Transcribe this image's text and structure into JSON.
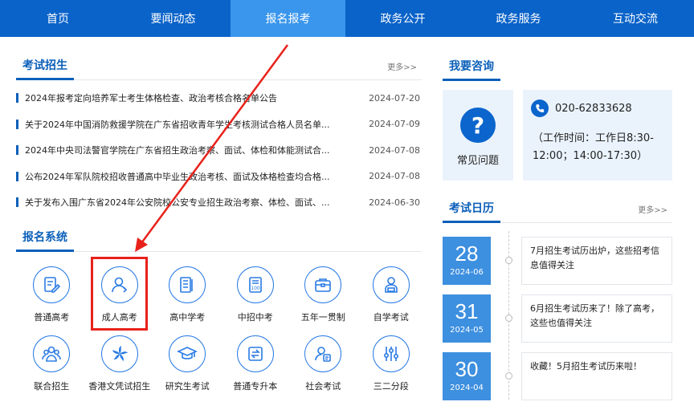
{
  "nav": {
    "items": [
      "首页",
      "要闻动态",
      "报名报考",
      "政务公开",
      "政务服务",
      "互动交流"
    ],
    "active_index": 2
  },
  "exam": {
    "title": "考试招生",
    "more": "更多>>",
    "news": [
      {
        "title": "2024年报考定向培养军士考生体格检查、政治考核合格名单公告",
        "date": "2024-07-20"
      },
      {
        "title": "关于2024年中国消防救援学院在广东省招收青年学生考核测试合格人员名单...",
        "date": "2024-07-09"
      },
      {
        "title": "2024年中央司法警官学院在广东省招生政治考察、面试、体检和体能测试合...",
        "date": "2024-07-08"
      },
      {
        "title": "公布2024年军队院校招收普通高中毕业生政治考核、面试及体格检查均合格...",
        "date": "2024-07-08"
      },
      {
        "title": "关于发布入围广东省2024年公安院校公安专业招生政治考察、体检、面试、...",
        "date": "2024-06-30"
      }
    ]
  },
  "system": {
    "title": "报名系统",
    "items": [
      {
        "label": "普通高考",
        "icon": "exam-pen-icon"
      },
      {
        "label": "成人高考",
        "icon": "adult-person-icon"
      },
      {
        "label": "高中学考",
        "icon": "document-list-icon"
      },
      {
        "label": "中招中考",
        "icon": "doc-100-icon"
      },
      {
        "label": "五年一贯制",
        "icon": "briefcase-icon"
      },
      {
        "label": "自学考试",
        "icon": "self-study-person-icon"
      },
      {
        "label": "联合招生",
        "icon": "group-people-icon"
      },
      {
        "label": "香港文凭试招生",
        "icon": "bauhinia-flower-icon"
      },
      {
        "label": "研究生考试",
        "icon": "graduation-cap-icon"
      },
      {
        "label": "普通专升本",
        "icon": "upgrade-doc-icon"
      },
      {
        "label": "社会考试",
        "icon": "person-card-icon"
      },
      {
        "label": "三二分段",
        "icon": "sliders-icon"
      }
    ],
    "highlighted": "成人高考"
  },
  "consult": {
    "title": "我要咨询",
    "faq_label": "常见问题",
    "phone": "020-62833628",
    "work_time": "（工作时间：工作日8:30-12:00；14:00-17:30）"
  },
  "calendar": {
    "title": "考试日历",
    "more": "更多>>",
    "items": [
      {
        "day": "28",
        "ym": "2024-06",
        "text": "7月招生考试历出炉，这些招考信息值得关注"
      },
      {
        "day": "31",
        "ym": "2024-05",
        "text": "6月招生考试历来了！除了高考，这些也值得关注"
      },
      {
        "day": "30",
        "ym": "2024-04",
        "text": "收藏！5月招生考试历来啦！"
      }
    ]
  },
  "colors": {
    "nav_bg": "#0a63c9",
    "nav_active": "#3a96ec",
    "accent": "#0b5fb9",
    "highlight": "#e8221b"
  }
}
